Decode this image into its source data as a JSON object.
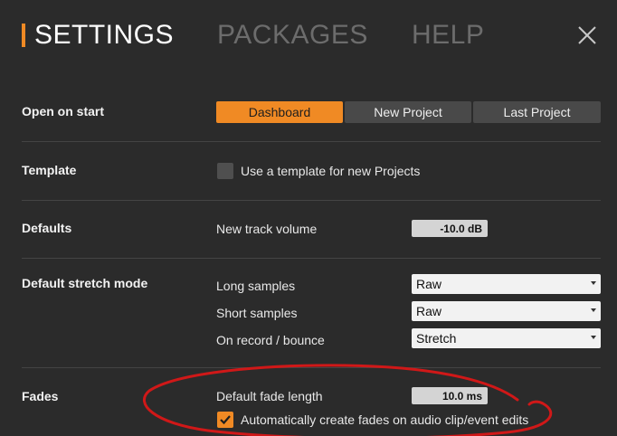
{
  "header": {
    "tabs": [
      {
        "label": "SETTINGS",
        "active": true
      },
      {
        "label": "PACKAGES",
        "active": false
      },
      {
        "label": "HELP",
        "active": false
      }
    ],
    "close_icon": "close-icon",
    "accent_color": "#f08a24"
  },
  "open_on_start": {
    "label": "Open on start",
    "options": [
      "Dashboard",
      "New Project",
      "Last Project"
    ],
    "selected": "Dashboard"
  },
  "template": {
    "label": "Template",
    "checkbox_label": "Use a template for new Projects",
    "checked": false
  },
  "defaults": {
    "label": "Defaults",
    "new_track_volume_label": "New track volume",
    "new_track_volume_value": "-10.0 dB"
  },
  "stretch": {
    "label": "Default stretch mode",
    "long_label": "Long samples",
    "long_value": "Raw",
    "short_label": "Short samples",
    "short_value": "Raw",
    "record_label": "On record / bounce",
    "record_value": "Stretch"
  },
  "fades": {
    "label": "Fades",
    "fade_length_label": "Default fade length",
    "fade_length_value": "10.0 ms",
    "auto_fades_label": "Automatically create fades on audio clip/event edits",
    "auto_fades_checked": true
  },
  "annotation_color": "#d01818"
}
